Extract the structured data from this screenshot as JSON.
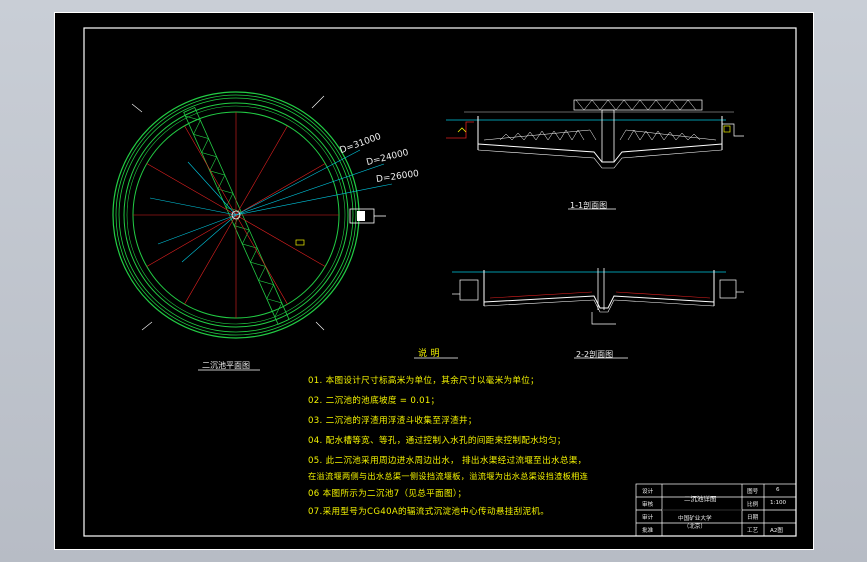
{
  "plan": {
    "title": "二沉池平面图",
    "dims": [
      "D=31000",
      "D=24000",
      "D=26000"
    ]
  },
  "sections": {
    "s1_title": "1-1剖面图",
    "s2_title": "2-2剖面图"
  },
  "notes": {
    "heading": "说    明",
    "lines": [
      "01.  本图设计尺寸标高米为单位，其余尺寸以毫米为单位；",
      "02.  二沉池的池底坡度 = 0.01；",
      "03.  二沉池的浮渣用浮渣斗收集至浮渣井；",
      "04.  配水槽等宽、等孔，通过控制入水孔的间距来控制配水均匀；",
      "05.  此二沉池采用周边进水周边出水，  排出水渠经过流堰至出水总渠，",
      "      在溢流堰两侧与出水总渠一侧设挡流堰板，溢流堰为出水总渠设挡渣板相连",
      "06    本图所示为二沉池7（见总平面图）；",
      "07.采用型号为CG40A的辐流式沉淀池中心传动悬挂刮泥机。"
    ]
  },
  "title_block": {
    "design_label": "设计",
    "check_label": "审核",
    "audit_label": "审计",
    "approve_label": "批准",
    "drawing_name": "二沉池详图",
    "sheet_label": "图号",
    "sheet_value": "6",
    "scale_label": "比例",
    "scale_value": "1:100",
    "date_label": "日期",
    "school": "中国矿业大学\n（北京）",
    "craft_label": "工艺",
    "paper_size": "A2图"
  },
  "colors": {
    "green": "#22cc44",
    "red": "#e02020",
    "cyan": "#00c8e0",
    "yellow": "#f2f200",
    "white": "#ffffff",
    "background": "#000000"
  }
}
